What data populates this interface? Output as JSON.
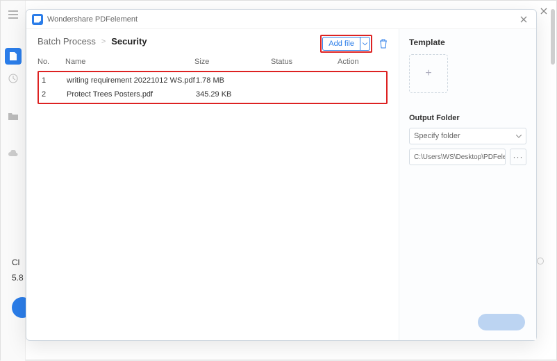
{
  "app": {
    "title": "Wondershare PDFelement"
  },
  "bg": {
    "label1": "Cl",
    "label2": "5.8"
  },
  "breadcrumb": {
    "parent": "Batch Process",
    "sep": ">",
    "current": "Security"
  },
  "toolbar": {
    "add_file": "Add file"
  },
  "table": {
    "headers": {
      "no": "No.",
      "name": "Name",
      "size": "Size",
      "status": "Status",
      "action": "Action"
    },
    "rows": [
      {
        "no": "1",
        "name": "writing requirement 20221012 WS.pdf",
        "size": "1.78 MB",
        "status": "",
        "action": ""
      },
      {
        "no": "2",
        "name": "Protect Trees Posters.pdf",
        "size": "345.29 KB",
        "status": "",
        "action": ""
      }
    ]
  },
  "rightpane": {
    "template_title": "Template",
    "template_add": "+",
    "output_folder_label": "Output Folder",
    "specify_placeholder": "Specify folder",
    "path": "C:\\Users\\WS\\Desktop\\PDFelement\\Sec",
    "browse": "···"
  }
}
